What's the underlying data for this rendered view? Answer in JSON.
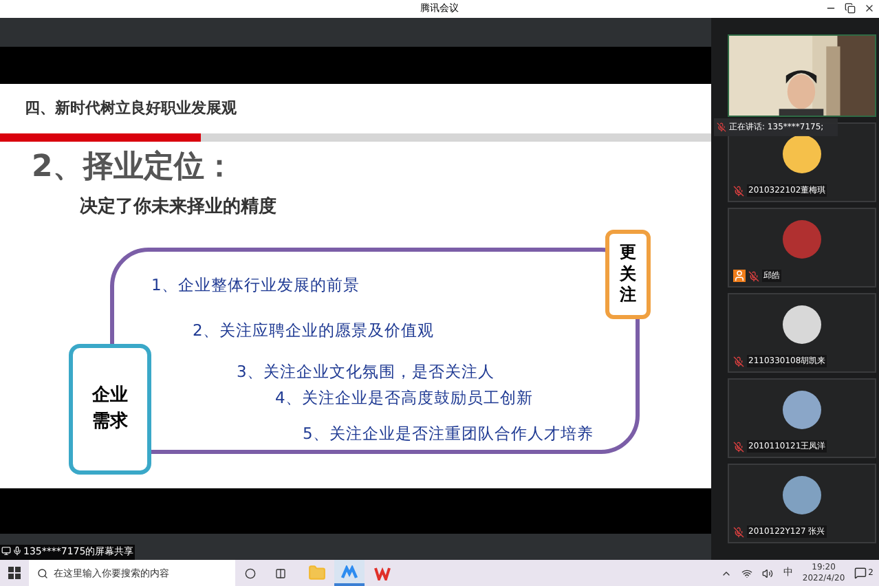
{
  "window": {
    "title": "腾讯会议"
  },
  "slide": {
    "section": "四、新时代树立良好职业发展观",
    "heading": "2、择业定位：",
    "subtitle": "决定了你未来择业的**精度**",
    "side_box": "更关注",
    "main_box": "企业需求",
    "items": [
      "1、企业整体行业发展的前景",
      "2、关注应聘企业的愿景及价值观",
      "3、关注企业文化氛围，是否关注人",
      "4、关注企业是否高度鼓励员工创新",
      "5、关注企业是否注重团队合作人才培养"
    ]
  },
  "speaking": "正在讲话: 135****7175;",
  "share_label": "135****7175的屏幕共享",
  "participants": [
    {
      "name": "2010322102董梅琪",
      "host": false,
      "color": "#f5c04a"
    },
    {
      "name": "邱皓",
      "host": true,
      "color": "#b03030"
    },
    {
      "name": "2110330108胡凯来",
      "host": false,
      "color": "#d8d8d8"
    },
    {
      "name": "2010110121王凤洋",
      "host": false,
      "color": "#8aa6c8"
    },
    {
      "name": "2010122Y127 张兴",
      "host": false,
      "color": "#7fa0c0"
    }
  ],
  "taskbar": {
    "search_placeholder": "在这里输入你要搜索的内容",
    "ime": "中",
    "time": "19:20",
    "date": "2022/4/20",
    "notifications": "2",
    "apps": [
      {
        "kind": "explorer",
        "selected": false
      },
      {
        "kind": "meeting",
        "selected": true
      },
      {
        "kind": "wps",
        "selected": false
      }
    ]
  }
}
